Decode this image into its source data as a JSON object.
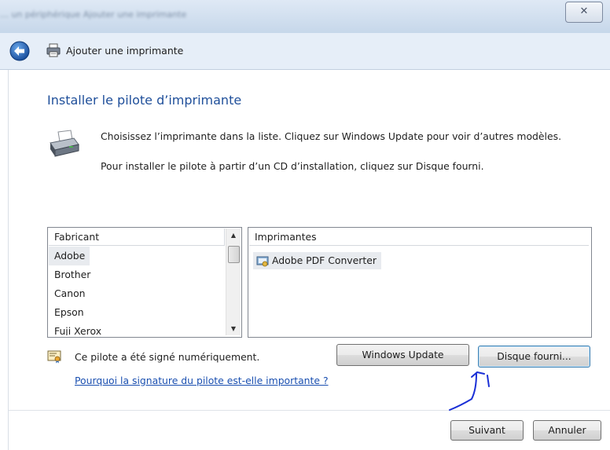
{
  "window": {
    "title_blurred": "… un périphérique    Ajouter une imprimante",
    "close_glyph": "✕"
  },
  "nav": {
    "title": "Ajouter une imprimante"
  },
  "main": {
    "heading": "Installer le pilote d’imprimante",
    "instruction_1": "Choisissez l’imprimante dans la liste. Cliquez sur Windows Update pour voir d’autres modèles.",
    "instruction_2": "Pour installer le pilote à partir d’un CD d’installation, cliquez sur Disque fourni."
  },
  "manufacturers": {
    "header": "Fabricant",
    "items": [
      "Adobe",
      "Brother",
      "Canon",
      "Epson",
      "Fuji Xerox"
    ],
    "selected": "Adobe"
  },
  "printers": {
    "header": "Imprimantes",
    "items": [
      "Adobe PDF Converter"
    ],
    "selected": "Adobe PDF Converter"
  },
  "driver": {
    "signed_text": "Ce pilote a été signé numériquement.",
    "signature_link": "Pourquoi la signature du pilote est-elle importante ?"
  },
  "buttons": {
    "windows_update": "Windows Update",
    "have_disk": "Disque fourni...",
    "next": "Suivant",
    "cancel": "Annuler"
  },
  "colors": {
    "heading": "#1f4f9a",
    "link": "#1a4fb0",
    "annotation": "#1a2fd6"
  }
}
